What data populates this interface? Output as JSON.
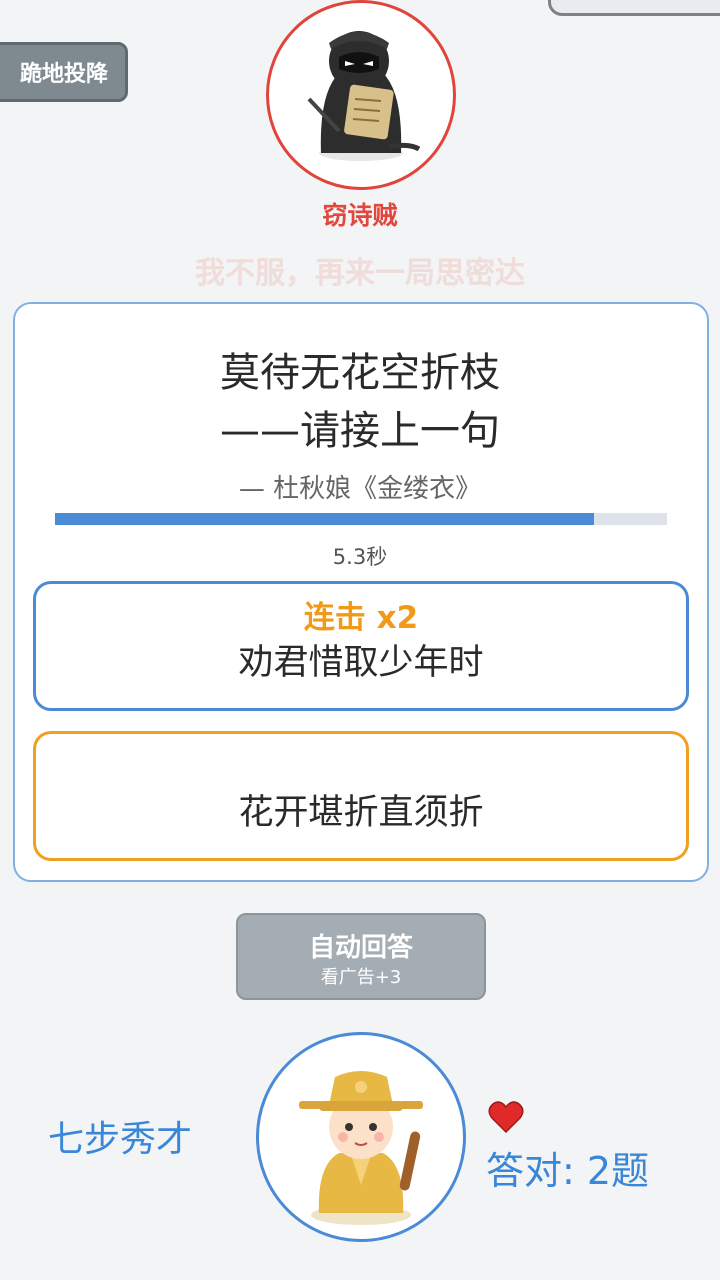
{
  "opponent": {
    "surrender_label": "跪地投降",
    "name": "窃诗贼",
    "taunt": "我不服，再来一局思密达",
    "avatar_icon": "ninja-thief-avatar"
  },
  "question": {
    "line1": "莫待无花空折枝",
    "line2": "——请接上一句",
    "source": "— 杜秋娘《金缕衣》",
    "timer_progress": 0.88,
    "timer_text": "5.3秒"
  },
  "options": [
    {
      "combo": "连击 x2",
      "text": "劝君惜取少年时",
      "border_color": "#4a8ad6"
    },
    {
      "text": "花开堪折直须折",
      "border_color": "#f0a020"
    }
  ],
  "auto_answer": {
    "label": "自动回答",
    "sublabel": "看广告+3"
  },
  "player": {
    "name": "七步秀才",
    "avatar_icon": "scholar-avatar",
    "lives_icon": "heart-icon",
    "score": "答对: 2题"
  },
  "colors": {
    "accent_blue": "#4a8ad6",
    "opponent_red": "#e3463c",
    "combo_orange": "#f09a18"
  }
}
